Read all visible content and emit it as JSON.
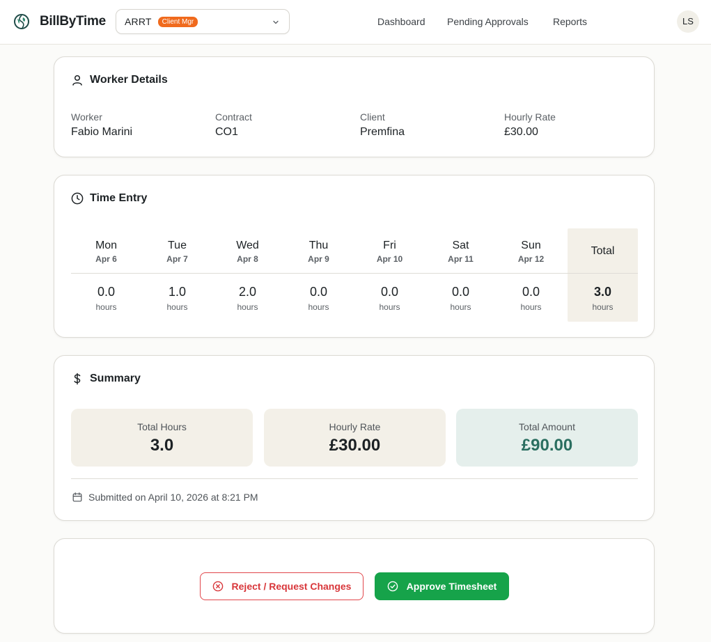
{
  "header": {
    "brand": "BillByTime",
    "org_select": {
      "value": "ARRT",
      "badge": "Client Mgr"
    },
    "nav": [
      "Dashboard",
      "Pending Approvals",
      "Reports"
    ],
    "avatar_initials": "LS"
  },
  "worker_details": {
    "title": "Worker Details",
    "fields": [
      {
        "label": "Worker",
        "value": "Fabio Marini"
      },
      {
        "label": "Contract",
        "value": "CO1"
      },
      {
        "label": "Client",
        "value": "Premfina"
      },
      {
        "label": "Hourly Rate",
        "value": "£30.00"
      }
    ]
  },
  "time_entry": {
    "title": "Time Entry",
    "days": [
      {
        "day": "Mon",
        "date": "Apr 6",
        "hours": "0.0",
        "unit": "hours"
      },
      {
        "day": "Tue",
        "date": "Apr 7",
        "hours": "1.0",
        "unit": "hours"
      },
      {
        "day": "Wed",
        "date": "Apr 8",
        "hours": "2.0",
        "unit": "hours"
      },
      {
        "day": "Thu",
        "date": "Apr 9",
        "hours": "0.0",
        "unit": "hours"
      },
      {
        "day": "Fri",
        "date": "Apr 10",
        "hours": "0.0",
        "unit": "hours"
      },
      {
        "day": "Sat",
        "date": "Apr 11",
        "hours": "0.0",
        "unit": "hours"
      },
      {
        "day": "Sun",
        "date": "Apr 12",
        "hours": "0.0",
        "unit": "hours"
      }
    ],
    "total": {
      "label": "Total",
      "hours": "3.0",
      "unit": "hours"
    }
  },
  "summary": {
    "title": "Summary",
    "total_hours": {
      "label": "Total Hours",
      "value": "3.0"
    },
    "hourly_rate": {
      "label": "Hourly Rate",
      "value": "£30.00"
    },
    "total_amount": {
      "label": "Total Amount",
      "value": "£90.00"
    },
    "submitted": "Submitted on April 10, 2026 at 8:21 PM"
  },
  "actions": {
    "reject_label": "Reject / Request Changes",
    "approve_label": "Approve Timesheet"
  },
  "colors": {
    "brand_green": "#16a34a",
    "reject_red": "#d8363a",
    "badge_orange": "#f06a1d",
    "amount_teal": "#2a6e60",
    "beige_tile": "#f3f0e8",
    "teal_tile": "#e5efec"
  },
  "icons": {
    "logo": "globe-leaf-icon",
    "worker_details": "user-icon",
    "time_entry": "clock-icon",
    "summary": "dollar-icon",
    "submitted": "calendar-icon",
    "org_select": "chevron-down-icon",
    "reject": "x-circle-icon",
    "approve": "check-circle-icon"
  }
}
